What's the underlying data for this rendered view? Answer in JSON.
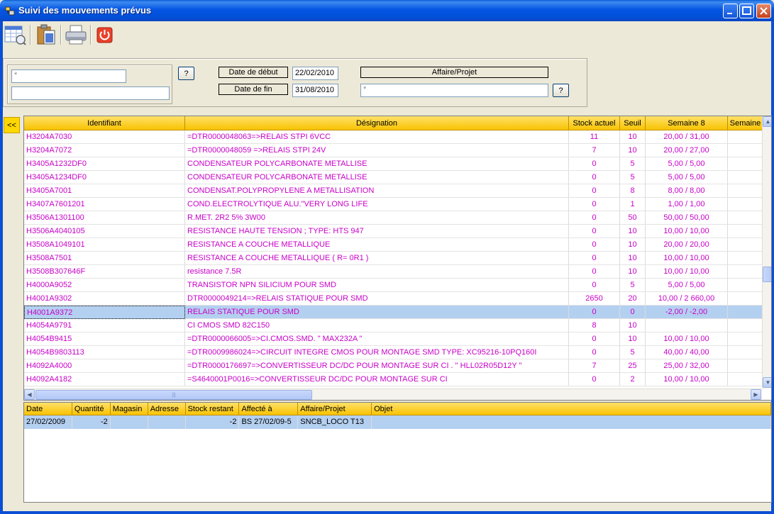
{
  "window": {
    "title": "Suivi des mouvements prévus"
  },
  "toolbar": {
    "buttons": [
      {
        "name": "calendar-search-icon"
      },
      {
        "name": "clipboard-icon"
      },
      {
        "name": "printer-icon"
      },
      {
        "name": "power-icon"
      }
    ]
  },
  "filter": {
    "identifier_value": "*",
    "designation_value": "",
    "help_label": "?",
    "date_debut_label": "Date de début",
    "date_debut_value": "22/02/2010",
    "date_fin_label": "Date de fin",
    "date_fin_value": "31/08/2010",
    "affaire_label": "Affaire/Projet",
    "affaire_value": "*",
    "affaire_help_label": "?"
  },
  "collapse_label": "<<",
  "grid": {
    "columns": [
      "Identifiant",
      "Désignation",
      "Stock actuel",
      "Seuil",
      "Semaine 8",
      "Semaine"
    ],
    "rows": [
      [
        "H3204A7030",
        "=DTR0000048063=>RELAIS STPI 6VCC",
        "11",
        "10",
        "20,00 / 31,00",
        ""
      ],
      [
        "H3204A7072",
        "=DTR0000048059 =>RELAIS STPI 24V",
        "7",
        "10",
        "20,00 / 27,00",
        ""
      ],
      [
        "H3405A1232DF0",
        "CONDENSATEUR POLYCARBONATE METALLISE",
        "0",
        "5",
        "5,00 / 5,00",
        ""
      ],
      [
        "H3405A1234DF0",
        "CONDENSATEUR POLYCARBONATE METALLISE",
        "0",
        "5",
        "5,00 / 5,00",
        ""
      ],
      [
        "H3405A7001",
        "CONDENSAT.POLYPROPYLENE A METALLISATION",
        "0",
        "8",
        "8,00 / 8,00",
        ""
      ],
      [
        "H3407A7601201",
        "COND.ELECTROLYTIQUE ALU.\"VERY LONG LIFE",
        "0",
        "1",
        "1,00 / 1,00",
        ""
      ],
      [
        "H3506A1301100",
        "R.MET.  2R2  5% 3W00",
        "0",
        "50",
        "50,00 / 50,00",
        ""
      ],
      [
        "H3506A4040105",
        "RESISTANCE HAUTE TENSION ; TYPE: HTS 947",
        "0",
        "10",
        "10,00 / 10,00",
        ""
      ],
      [
        "H3508A1049101",
        "RESISTANCE A COUCHE METALLIQUE",
        "0",
        "10",
        "20,00 / 20,00",
        ""
      ],
      [
        "H3508A7501",
        "RESISTANCE A COUCHE METALLIQUE ( R= 0R1 )",
        "0",
        "10",
        "10,00 / 10,00",
        ""
      ],
      [
        "H3508B307646F",
        "resistance 7.5R",
        "0",
        "10",
        "10,00 / 10,00",
        ""
      ],
      [
        "H4000A9052",
        "TRANSISTOR NPN SILICIUM POUR SMD",
        "0",
        "5",
        "5,00 / 5,00",
        ""
      ],
      [
        "H4001A9302",
        "DTR0000049214=>RELAIS STATIQUE POUR SMD",
        "2650",
        "20",
        "10,00 / 2 660,00",
        ""
      ],
      [
        "H4001A9372",
        "RELAIS STATIQUE POUR SMD",
        "0",
        "0",
        "-2,00 / -2,00",
        ""
      ],
      [
        "H4054A9791",
        "CI CMOS SMD  82C150",
        "8",
        "10",
        "",
        ""
      ],
      [
        "H4054B9415",
        "=DTR0000066005=>CI.CMOS.SMD.  \" MAX232A \"",
        "0",
        "10",
        "10,00 / 10,00",
        ""
      ],
      [
        "H4054B9803113",
        "=DTR0009986024=>CIRCUIT INTEGRE CMOS POUR MONTAGE SMD  TYPE: XC95216-10PQ160I",
        "0",
        "5",
        "40,00 / 40,00",
        ""
      ],
      [
        "H4092A4000",
        "=DTR0000176697=>CONVERTISSEUR DC/DC POUR MONTAGE SUR CI .  \" HLL02R05D12Y  \"",
        "7",
        "25",
        "25,00 / 32,00",
        ""
      ],
      [
        "H4092A4182",
        "=S4640001P0016=>CONVERTISSEUR DC/DC POUR MONTAGE SUR CI",
        "0",
        "2",
        "10,00 / 10,00",
        ""
      ]
    ],
    "selected_index": 13
  },
  "detail": {
    "columns": [
      "Date",
      "Quantité",
      "Magasin",
      "Adresse",
      "Stock restant",
      "Affecté à",
      "Affaire/Projet",
      "Objet"
    ],
    "rows": [
      [
        "27/02/2009",
        "-2",
        "",
        "",
        "-2",
        "BS 27/02/09-5",
        "SNCB_LOCO T13",
        ""
      ]
    ]
  },
  "colors": {
    "header_yellow": "#f8c300",
    "row_text": "#c800c8",
    "selection": "#b4d0f0",
    "titlebar": "#0554e3"
  }
}
